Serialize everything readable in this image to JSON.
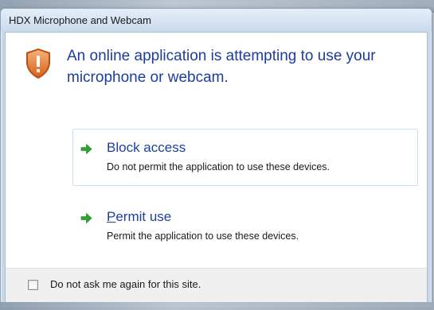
{
  "window": {
    "title": "HDX Microphone and Webcam"
  },
  "prompt": {
    "heading": "An online application is attempting to use your microphone or webcam."
  },
  "options": [
    {
      "title": "Block access",
      "description": "Do not permit the application to use these devices.",
      "icon": "green-arrow-icon"
    },
    {
      "title_mnemonic": "P",
      "title_rest": "ermit use",
      "description": "Permit the application to use these devices.",
      "icon": "green-arrow-icon"
    }
  ],
  "footer": {
    "checkbox_label": "Do not ask me again for this site.",
    "checked": false
  },
  "colors": {
    "heading": "#1c3d9e",
    "arrow": "#2fa32f",
    "shield": "#e8742a"
  }
}
